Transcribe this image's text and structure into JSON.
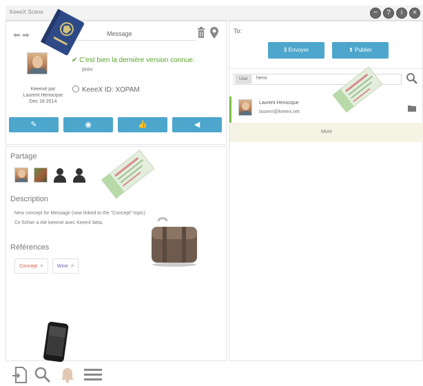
{
  "window": {
    "title": "KeeeX Scene",
    "buttons": [
      "−",
      "?",
      "i",
      "×"
    ]
  },
  "message": {
    "title": "Message",
    "status": "C'est bien la dernière version connue.",
    "status_sub": "prev",
    "author_line1": "Keeexé par",
    "author_name": "Laurent Henocque",
    "date": "Dec 18 2014",
    "kid_label": "KeeeX ID: XOPAM"
  },
  "actions": [
    {
      "icon": "pencil-icon",
      "glyph": "✎"
    },
    {
      "icon": "eye-icon",
      "glyph": "◉"
    },
    {
      "icon": "thumbs-up-icon",
      "glyph": "👍"
    },
    {
      "icon": "megaphone-icon",
      "glyph": "◀"
    }
  ],
  "sharing": {
    "label": "Partage"
  },
  "description": {
    "label": "Description",
    "line1": "New concept for Message (now linked to the \"Concept\" topic)",
    "line2": "Ce fichier a été keeexé avec KeeeX beta."
  },
  "references": {
    "label": "Références",
    "tags": [
      {
        "label": "Concept",
        "color": "#d35a3a"
      },
      {
        "label": "Wine",
        "color": "#6060b0"
      }
    ]
  },
  "recipients": {
    "to_label": "To:",
    "send_label": "Envoyer",
    "publish_label": "Publier",
    "search_chip": "User",
    "search_value": "heno",
    "result_name": "Laurent Henocque",
    "result_email": "laurent@keeex.net",
    "more_label": "More"
  },
  "colors": {
    "accent": "#4da6cc",
    "status_green": "#5aa02c",
    "more_bg": "#f5f3e4"
  }
}
